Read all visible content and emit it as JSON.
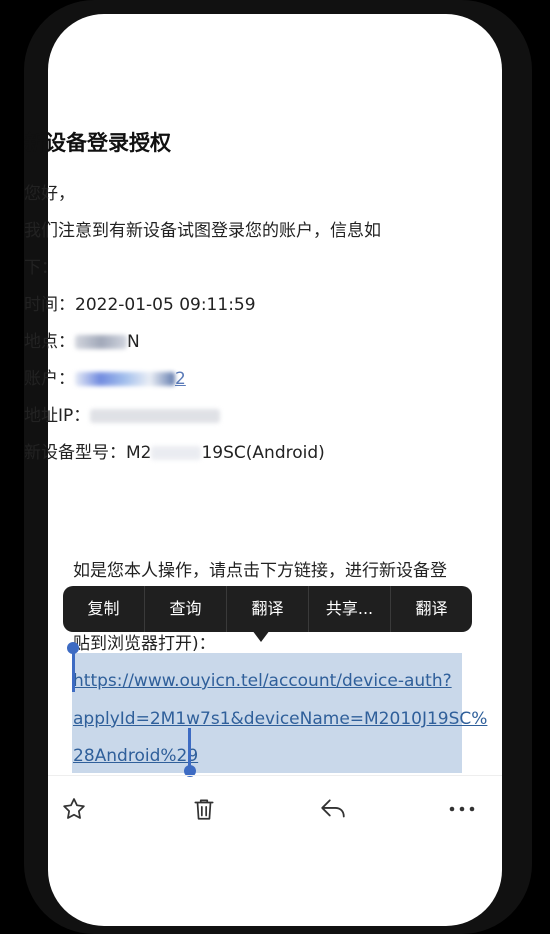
{
  "email": {
    "title": "新设备登录授权",
    "greeting": "您好，",
    "intro_line1": "我们注意到有新设备试图登录您的账户，信息如",
    "intro_line2": "下：",
    "time_label": "时间：",
    "time_value": "2022-01-05 09:11:59",
    "location_label": "地点：",
    "location_visible_suffix": "N",
    "account_label": "账户：",
    "account_visible_suffix": "2",
    "ip_label": "地址IP：",
    "model_label": "新设备型号：",
    "model_prefix": "M2",
    "model_suffix": "19SC(Android)",
    "instruction_line": "如是您本人操作，请点击下方链接，进行新设备登",
    "paste_line": "贴到浏览器打开)：",
    "link_line1": "https://www.ouyicn.tel/account/device-auth?",
    "link_line2": "applyId=2M1w7s1&deviceName=M2010J19SC%",
    "link_line3": "28Android%29"
  },
  "context_menu": {
    "items": [
      "复制",
      "查询",
      "翻译",
      "共享...",
      "翻译"
    ]
  },
  "toolbar": {
    "icons": [
      "star-icon",
      "trash-icon",
      "reply-icon",
      "more-icon"
    ]
  },
  "colors": {
    "link": "#2f5f9a",
    "selection": "#c9d8ea",
    "selection_handle": "#3d6bc3",
    "menu_bg": "#1f1f1f"
  }
}
